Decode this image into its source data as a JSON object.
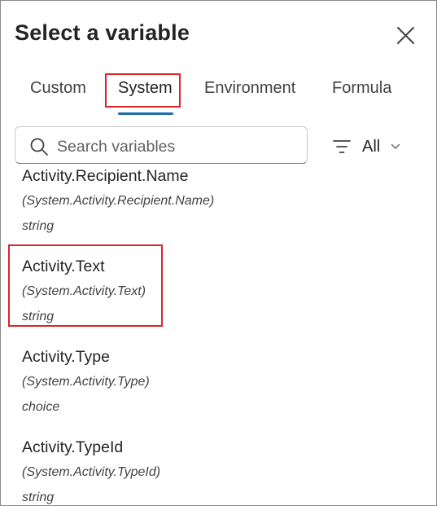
{
  "dialog": {
    "title": "Select a variable",
    "close_label": "Close"
  },
  "tabs": [
    {
      "label": "Custom",
      "selected": false
    },
    {
      "label": "System",
      "selected": true
    },
    {
      "label": "Environment",
      "selected": false
    },
    {
      "label": "Formula",
      "selected": false
    }
  ],
  "search": {
    "placeholder": "Search variables",
    "value": ""
  },
  "filter": {
    "label": "All",
    "icon": "filter-lines-icon"
  },
  "variables": [
    {
      "name": "Activity.Recipient.Name",
      "path": "(System.Activity.Recipient.Name)",
      "type": "string"
    },
    {
      "name": "Activity.Text",
      "path": "(System.Activity.Text)",
      "type": "string",
      "highlighted": true
    },
    {
      "name": "Activity.Type",
      "path": "(System.Activity.Type)",
      "type": "choice"
    },
    {
      "name": "Activity.TypeId",
      "path": "(System.Activity.TypeId)",
      "type": "string"
    }
  ],
  "colors": {
    "highlight_border": "#d9252c",
    "tab_underline": "#1f6bad",
    "text": "#242424"
  }
}
